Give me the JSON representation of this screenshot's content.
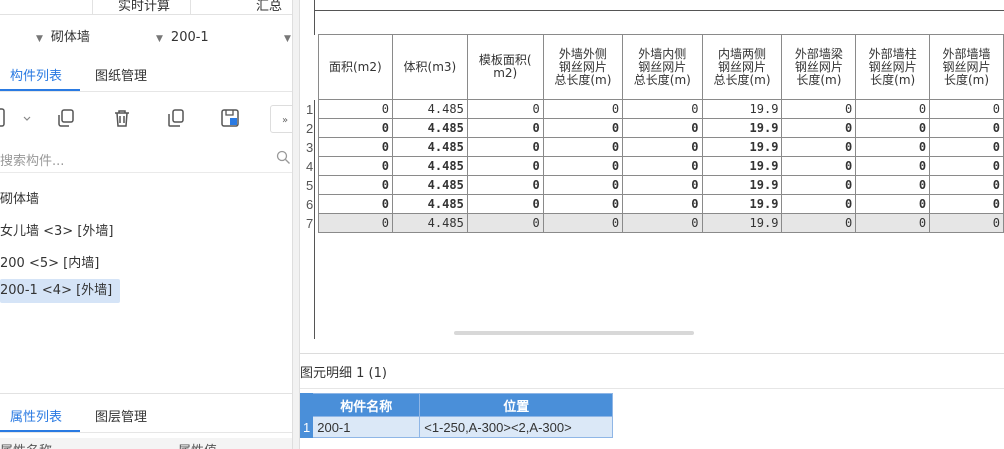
{
  "top_tabs": [
    "实时计算",
    "汇总"
  ],
  "dropdowns": {
    "category": "砌体墙",
    "member": "200-1"
  },
  "left_tabs": {
    "active": "构件列表",
    "other": "图纸管理"
  },
  "search": {
    "placeholder": "搜索构件..."
  },
  "tree": {
    "group": "砌体墙",
    "items": [
      "女儿墙 <3> [外墙]",
      "200 <5> [内墙]",
      "200-1 <4> [外墙]"
    ]
  },
  "bottom_tabs": {
    "active": "属性列表",
    "other": "图层管理"
  },
  "prop_header": {
    "name": "属性名称",
    "value": "属性值"
  },
  "table": {
    "headers": [
      "面积(m2)",
      "体积(m3)",
      "模板面积(m2)",
      "外墙外侧钢丝网片总长度(m)",
      "外墙内侧钢丝网片总长度(m)",
      "内墙两侧钢丝网片总长度(m)",
      "外部墙梁钢丝网片长度(m)",
      "外部墙柱钢丝网片长度(m)",
      "外部墙墙钢丝网片长度(m)"
    ],
    "header_lines": [
      [
        "面积(m2)"
      ],
      [
        "体积(m3)"
      ],
      [
        "模板面积(",
        "m2)"
      ],
      [
        "外墙外侧",
        "钢丝网片",
        "总长度(m)"
      ],
      [
        "外墙内侧",
        "钢丝网片",
        "总长度(m)"
      ],
      [
        "内墙两侧",
        "钢丝网片",
        "总长度(m)"
      ],
      [
        "外部墙梁",
        "钢丝网片",
        "长度(m)"
      ],
      [
        "外部墙柱",
        "钢丝网片",
        "长度(m)"
      ],
      [
        "外部墙墙",
        "钢丝网片",
        "长度(m)"
      ]
    ],
    "rows": [
      {
        "n": "1",
        "style": "normal",
        "cells": [
          "0",
          "4.485",
          "0",
          "0",
          "0",
          "19.9",
          "0",
          "0",
          "0"
        ]
      },
      {
        "n": "2",
        "style": "bold",
        "cells": [
          "0",
          "4.485",
          "0",
          "0",
          "0",
          "19.9",
          "0",
          "0",
          "0"
        ]
      },
      {
        "n": "3",
        "style": "bold",
        "cells": [
          "0",
          "4.485",
          "0",
          "0",
          "0",
          "19.9",
          "0",
          "0",
          "0"
        ]
      },
      {
        "n": "4",
        "style": "bold",
        "cells": [
          "0",
          "4.485",
          "0",
          "0",
          "0",
          "19.9",
          "0",
          "0",
          "0"
        ]
      },
      {
        "n": "5",
        "style": "bold",
        "cells": [
          "0",
          "4.485",
          "0",
          "0",
          "0",
          "19.9",
          "0",
          "0",
          "0"
        ]
      },
      {
        "n": "6",
        "style": "bold",
        "cells": [
          "0",
          "4.485",
          "0",
          "0",
          "0",
          "19.9",
          "0",
          "0",
          "0"
        ]
      },
      {
        "n": "7",
        "style": "gray",
        "cells": [
          "0",
          "4.485",
          "0",
          "0",
          "0",
          "19.9",
          "0",
          "0",
          "0"
        ]
      }
    ]
  },
  "detail": {
    "title": "图元明细  1 (1)",
    "headers": [
      "构件名称",
      "位置"
    ],
    "rows": [
      {
        "n": "1",
        "name": "200-1",
        "position": "<1-250,A-300><2,A-300>"
      }
    ]
  },
  "colors": {
    "accent": "#2a7ae2",
    "header_blue": "#4a8fd9",
    "selection": "#d5e4f7"
  }
}
